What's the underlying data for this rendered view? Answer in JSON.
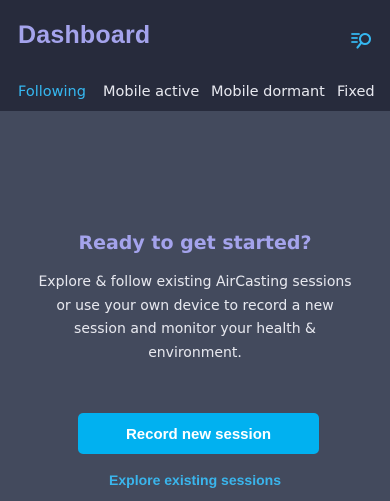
{
  "header": {
    "title": "Dashboard",
    "filter_icon": "filter-search-icon"
  },
  "tabs": [
    {
      "label": "Following",
      "active": true
    },
    {
      "label": "Mobile active",
      "active": false
    },
    {
      "label": "Mobile dormant",
      "active": false
    },
    {
      "label": "Fixed",
      "active": false
    }
  ],
  "empty_state": {
    "headline": "Ready to get started?",
    "body": "Explore & follow existing AirCasting sessions or use your own device to record a new session and monitor your health & environment.",
    "primary_button": "Record new session",
    "secondary_link": "Explore existing sessions"
  },
  "colors": {
    "header_bg": "#272b3c",
    "content_bg": "#434a5d",
    "accent_blue": "#01b1f0",
    "headline_purple": "#a4a3ec"
  }
}
